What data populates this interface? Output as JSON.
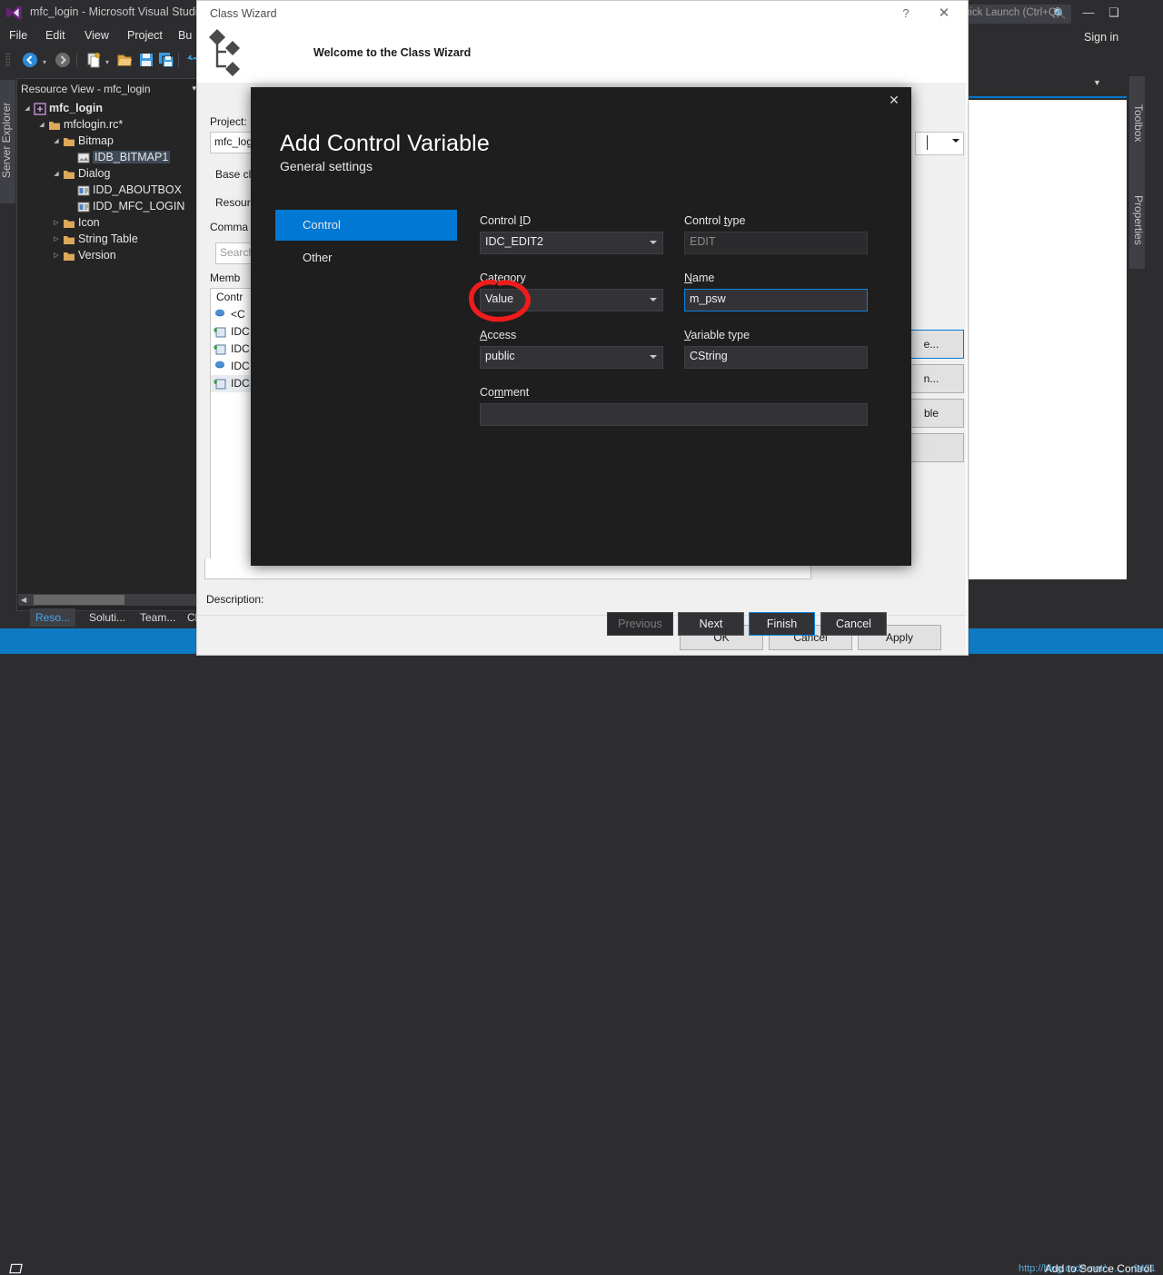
{
  "ide": {
    "title": "mfc_login - Microsoft Visual Studio",
    "logo_icon": "visual-studio-logo",
    "search_placeholder": "Quick Launch (Ctrl+Q)",
    "search_icon": "search-icon",
    "minimize_icon": "minimize-icon",
    "maximize_icon": "restore-icon",
    "close_icon": "close-icon",
    "sign_in": "Sign in",
    "account_icon": "account-icon",
    "menus": [
      "File",
      "Edit",
      "View",
      "Project",
      "Bu"
    ],
    "left_dock_tab": "Server Explorer",
    "right_dock_tabs": [
      "Toolbox",
      "Properties"
    ],
    "toolbar": {
      "back_icon": "navigate-back-icon",
      "back_caret": "▾",
      "forward_icon": "navigate-forward-icon",
      "new_project_icon": "new-project-icon",
      "new_caret": "▾",
      "open_icon": "open-file-icon",
      "save_icon": "save-icon",
      "save_all_icon": "save-all-icon",
      "undo_icon": "undo-icon"
    },
    "resource_view": {
      "header": "Resource View - mfc_login",
      "header_caret": "▾",
      "tree": [
        {
          "label": "mfc_login",
          "indent": 0,
          "arrow": "◢",
          "icon": "project-icon",
          "bold": true,
          "selected": false
        },
        {
          "label": "mfclogin.rc*",
          "indent": 1,
          "arrow": "◢",
          "icon": "folder-icon",
          "bold": false,
          "selected": false
        },
        {
          "label": "Bitmap",
          "indent": 2,
          "arrow": "◢",
          "icon": "folder-icon",
          "bold": false,
          "selected": false
        },
        {
          "label": "IDB_BITMAP1",
          "indent": 3,
          "arrow": "",
          "icon": "bitmap-icon",
          "bold": false,
          "selected": true
        },
        {
          "label": "Dialog",
          "indent": 2,
          "arrow": "◢",
          "icon": "folder-icon",
          "bold": false,
          "selected": false
        },
        {
          "label": "IDD_ABOUTBOX",
          "indent": 3,
          "arrow": "",
          "icon": "dialog-icon",
          "bold": false,
          "selected": false
        },
        {
          "label": "IDD_MFC_LOGIN",
          "indent": 3,
          "arrow": "",
          "icon": "dialog-icon",
          "bold": false,
          "selected": false
        },
        {
          "label": "Icon",
          "indent": 2,
          "arrow": "▷",
          "icon": "folder-icon",
          "bold": false,
          "selected": false
        },
        {
          "label": "String Table",
          "indent": 2,
          "arrow": "▷",
          "icon": "folder-icon",
          "bold": false,
          "selected": false
        },
        {
          "label": "Version",
          "indent": 2,
          "arrow": "▷",
          "icon": "folder-icon",
          "bold": false,
          "selected": false
        }
      ]
    },
    "bottom_tabs": [
      {
        "label": "Reso...",
        "active": true
      },
      {
        "label": "Soluti...",
        "active": false
      },
      {
        "label": "Team...",
        "active": false
      },
      {
        "label": "Cl",
        "active": false
      }
    ],
    "status": {
      "icon": "ready-icon",
      "text": "Add to Source Control",
      "watermark": "http://blog.csdn.net/..........9421"
    },
    "panel_bottom": {
      "caret_icon": "chevron-down-icon",
      "pin_icon": "pin-icon",
      "close_icon": "close-icon"
    }
  },
  "class_wizard": {
    "window_title": "Class Wizard",
    "help_icon": "?",
    "close_icon": "✕",
    "banner_icon": "class-wizard-icon",
    "welcome": "Welcome to the Class Wizard",
    "labels": {
      "project": "Project:",
      "base_class": "Base cl",
      "resource": "Resour",
      "commands": "Comma",
      "members": "Memb",
      "description": "Description:"
    },
    "project_value": "mfc_log",
    "search_placeholder": "Search",
    "member_header": "Contr",
    "members": [
      {
        "label": "<C",
        "icon": "method-icon",
        "selected": false
      },
      {
        "label": "IDC",
        "icon": "variable-icon",
        "selected": false
      },
      {
        "label": "IDC",
        "icon": "variable-icon",
        "selected": false
      },
      {
        "label": "IDC",
        "icon": "method-icon",
        "selected": false
      },
      {
        "label": "IDC",
        "icon": "variable-icon",
        "selected": true
      }
    ],
    "side_buttons": [
      {
        "label": "e...",
        "primary": true
      },
      {
        "label": "n...",
        "primary": false
      },
      {
        "label": "ble",
        "primary": false
      },
      {
        "label": "",
        "primary": false
      }
    ],
    "footer_buttons": [
      {
        "label": "OK"
      },
      {
        "label": "Cancel"
      },
      {
        "label": "Apply"
      }
    ]
  },
  "modal": {
    "close_icon": "✕",
    "title": "Add Control Variable",
    "subtitle": "General settings",
    "nav": [
      {
        "label": "Control",
        "active": true
      },
      {
        "label": "Other",
        "active": false
      }
    ],
    "fields": {
      "control_id": {
        "label_pre": "Control ",
        "label_accel": "I",
        "label_post": "D",
        "value": "IDC_EDIT2",
        "type": "combo",
        "state": "normal"
      },
      "control_type": {
        "label_pre": "Control ",
        "label_accel": "t",
        "label_post": "ype",
        "value": "EDIT",
        "type": "text",
        "state": "readonly"
      },
      "category": {
        "label_pre": "Cat",
        "label_accel": "e",
        "label_post": "gory",
        "value": "Value",
        "type": "combo",
        "state": "normal"
      },
      "name": {
        "label_pre": "",
        "label_accel": "N",
        "label_post": "ame",
        "value": "m_psw",
        "type": "text",
        "state": "focused"
      },
      "access": {
        "label_pre": "",
        "label_accel": "A",
        "label_post": "ccess",
        "value": "public",
        "type": "combo",
        "state": "normal"
      },
      "variable_type": {
        "label_pre": "",
        "label_accel": "V",
        "label_post": "ariable type",
        "value": "CString",
        "type": "combo_text",
        "state": "normal"
      },
      "comment": {
        "label_pre": "Co",
        "label_accel": "m",
        "label_post": "ment",
        "value": "",
        "type": "text",
        "state": "normal"
      }
    },
    "buttons": [
      {
        "label": "Previous",
        "state": "disabled"
      },
      {
        "label": "Next",
        "state": "normal"
      },
      {
        "label": "Finish",
        "state": "default"
      },
      {
        "label": "Cancel",
        "state": "normal"
      }
    ]
  },
  "annotation": {
    "shape": "hand-drawn-ellipse",
    "color": "#f01c1c",
    "target": "Category combo box (Value)"
  },
  "colors": {
    "accent": "#0078d4",
    "status_bar": "#0e7ac4",
    "modal_bg": "#1e1e1e",
    "shell_bg": "#2d2d30",
    "annotation_red": "#f01c1c"
  }
}
